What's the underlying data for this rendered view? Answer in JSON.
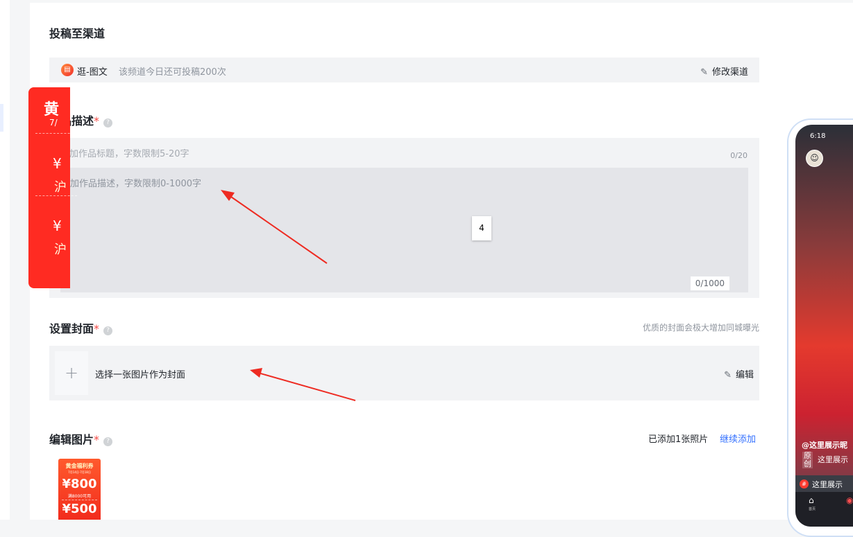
{
  "channel_section": {
    "title": "投稿至渠道",
    "channel_icon": "document-icon",
    "channel_name": "逛-图文",
    "quota": "该频道今日还可投稿200次",
    "modify_label": "修改渠道"
  },
  "description_section": {
    "title": "作品描述",
    "required_mark": "*",
    "title_placeholder": "添加作品标题，字数限制5-20字",
    "title_count": "0/20",
    "desc_placeholder": "添加作品描述，字数限制0-1000字",
    "desc_count": "0/1000",
    "page_badge": "4"
  },
  "cover_section": {
    "title": "设置封面",
    "required_mark": "*",
    "hint": "优质的封面会极大增加同城曝光",
    "add_symbol": "+",
    "choose_label": "选择一张图片作为封面",
    "edit_label": "编辑"
  },
  "images_section": {
    "title": "编辑图片",
    "required_mark": "*",
    "count_text": "已添加1张照片",
    "continue_label": "继续添加",
    "thumbnail": {
      "title": "黄金福利券",
      "date": "7月14日-7月18日",
      "value1": "¥800",
      "cond1": "满8000可用",
      "value2": "¥500"
    }
  },
  "phone_preview": {
    "time": "6:18",
    "poster_title": "黄",
    "poster_sub": "7/",
    "yen1": "¥",
    "cond1": "沪",
    "yen2": "¥",
    "cond2": "沪",
    "author": "@这里展示昵",
    "original": "原创",
    "desc": "这里展示",
    "topic": "这里展示",
    "nav_home": "首页"
  },
  "colors": {
    "accent_blue": "#3370ff",
    "required_red": "#f54a45",
    "annotation_arrow": "#ee2b22"
  }
}
